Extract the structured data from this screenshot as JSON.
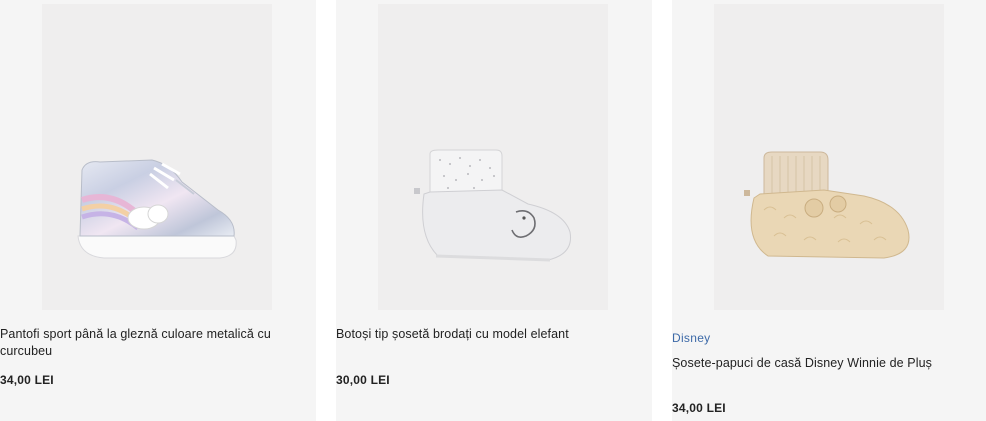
{
  "products": [
    {
      "brand": "",
      "title": "Pantofi sport până la gleznă culoare metalică cu curcubeu",
      "price": "34,00 LEI",
      "image_icon": "metallic-rainbow-sneaker"
    },
    {
      "brand": "",
      "title": "Botoși tip șosetă brodați cu model elefant",
      "price": "30,00 LEI",
      "image_icon": "elephant-sock-bootie"
    },
    {
      "brand": "Disney",
      "title": "Șosete-papuci de casă Disney Winnie de Pluș",
      "price": "34,00 LEI",
      "image_icon": "plush-winnie-slipper"
    }
  ]
}
